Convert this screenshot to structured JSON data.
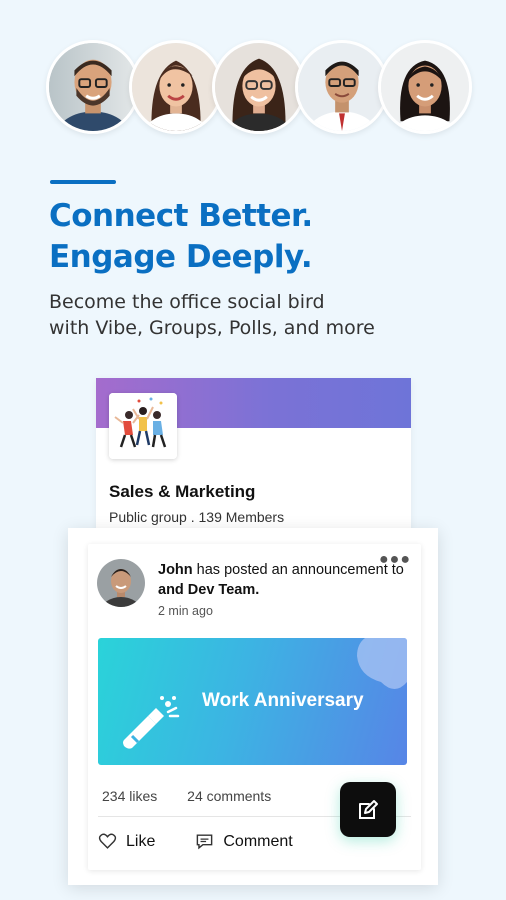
{
  "promo": {
    "headline_line1": "Connect Better.",
    "headline_line2": "Engage Deeply.",
    "subhead_line1": "Become the office social bird",
    "subhead_line2": "with Vibe, Groups, Polls, and more",
    "accent_color": "#0a6fc2"
  },
  "avatars": [
    {
      "icon": "man-beard-glasses-avatar"
    },
    {
      "icon": "woman-smiling-avatar"
    },
    {
      "icon": "woman-glasses-avatar"
    },
    {
      "icon": "man-glasses-tie-avatar"
    },
    {
      "icon": "woman-dark-hair-avatar"
    }
  ],
  "group": {
    "name": "Sales & Marketing",
    "meta": "Public group . 139 Members",
    "banner_color": "#8c70d2",
    "thumb_icon": "people-dancing-illustration"
  },
  "post": {
    "author": "John",
    "action_text": " has posted an announcement to ",
    "target": "and Dev Team.",
    "time": "2 min ago",
    "more_icon": "more-horizontal-icon",
    "banner_title": "Work Anniversary",
    "banner_icon": "champagne-bottle-icon",
    "likes": "234  likes",
    "comments": "24  comments",
    "like_label": "Like",
    "comment_label": "Comment"
  },
  "fab": {
    "icon": "edit-icon",
    "color": "#0d0d0d"
  }
}
